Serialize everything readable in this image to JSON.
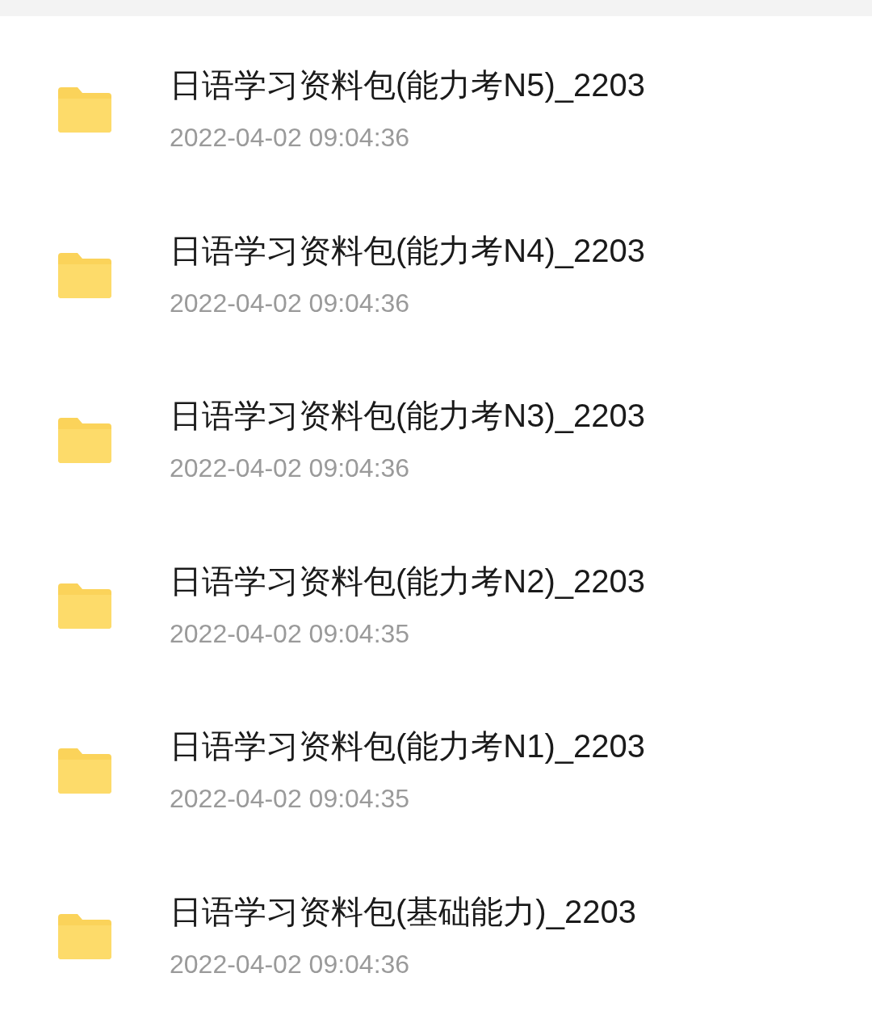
{
  "files": [
    {
      "kind": "folder",
      "name": "日语学习资料包(能力考N5)_2203",
      "modified": "2022-04-02 09:04:36"
    },
    {
      "kind": "folder",
      "name": "日语学习资料包(能力考N4)_2203",
      "modified": "2022-04-02 09:04:36"
    },
    {
      "kind": "folder",
      "name": "日语学习资料包(能力考N3)_2203",
      "modified": "2022-04-02 09:04:36"
    },
    {
      "kind": "folder",
      "name": "日语学习资料包(能力考N2)_2203",
      "modified": "2022-04-02 09:04:35"
    },
    {
      "kind": "folder",
      "name": "日语学习资料包(能力考N1)_2203",
      "modified": "2022-04-02 09:04:35"
    },
    {
      "kind": "folder",
      "name": "日语学习资料包(基础能力)_2203",
      "modified": "2022-04-02 09:04:36"
    }
  ]
}
